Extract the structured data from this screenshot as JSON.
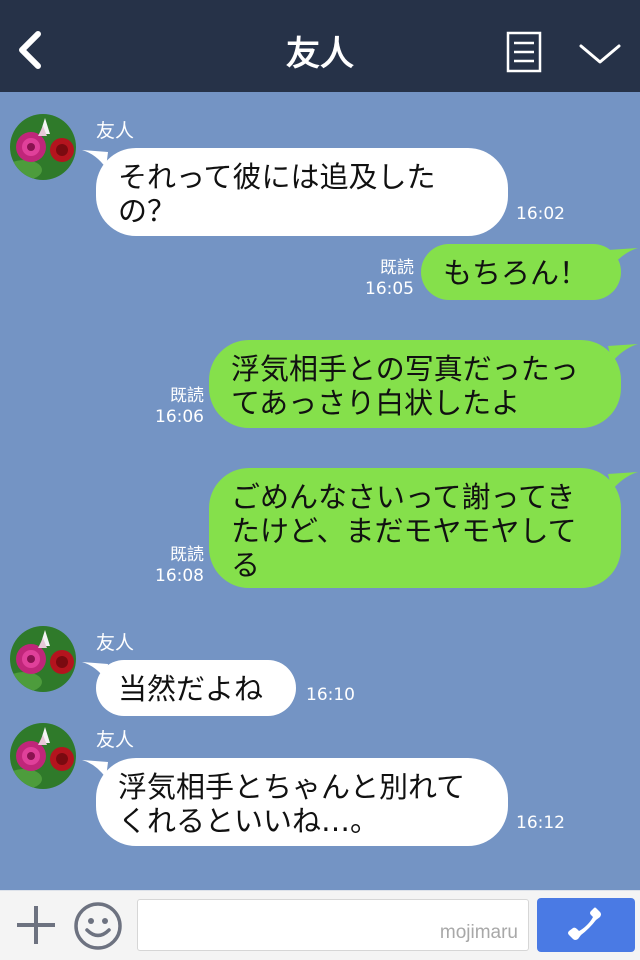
{
  "header": {
    "title": "友人",
    "back_icon": "chevron-left-icon",
    "note_icon": "note-icon",
    "menu_icon": "chevron-down-icon"
  },
  "messages": [
    {
      "side": "in",
      "sender": "友人",
      "text": "それって彼には追及したの？",
      "time": "16:02"
    },
    {
      "side": "out",
      "read": "既読",
      "text": "もちろん！",
      "time": "16:05"
    },
    {
      "side": "out",
      "read": "既読",
      "text": "浮気相手との写真だったってあっさり白状したよ",
      "time": "16:06"
    },
    {
      "side": "out",
      "read": "既読",
      "text": "ごめんなさいって謝ってきたけど、まだモヤモヤしてる",
      "time": "16:08"
    },
    {
      "side": "in",
      "sender": "友人",
      "text": "当然だよね",
      "time": "16:10"
    },
    {
      "side": "in",
      "sender": "友人",
      "text": "浮気相手とちゃんと別れてくれるといいね…。",
      "time": "16:12"
    }
  ],
  "footer": {
    "input_value": "",
    "watermark": "mojimaru",
    "plus_icon": "plus-icon",
    "emoji_icon": "smiley-icon",
    "call_icon": "phone-icon"
  },
  "colors": {
    "header_bg": "#263248",
    "chat_bg": "#7494c4",
    "bubble_in": "#ffffff",
    "bubble_out": "#85e04b",
    "call_button": "#4a7ae4"
  }
}
